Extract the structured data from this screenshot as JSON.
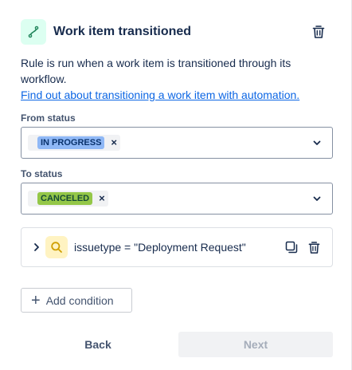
{
  "trigger": {
    "title": "Work item transitioned",
    "icon": "branch-icon",
    "icon_color": "#1f845a",
    "icon_bg": "#dcfff1"
  },
  "description": {
    "text": "Rule is run when a work item is transitioned through its workflow.",
    "link": "Find out about transitioning a work item with automation."
  },
  "from_status": {
    "label": "From status",
    "value": "IN PROGRESS",
    "lozenge_bg": "#8fb8f6",
    "lozenge_color": "#09326c"
  },
  "to_status": {
    "label": "To status",
    "value": "CANCELED",
    "lozenge_bg": "#94c748",
    "lozenge_color": "#164b35"
  },
  "condition": {
    "text": "issuetype = \"Deployment Request\"",
    "icon": "search-icon",
    "icon_color": "#cf9f02"
  },
  "actions": {
    "add_condition": "Add condition",
    "back": "Back",
    "next": "Next"
  }
}
